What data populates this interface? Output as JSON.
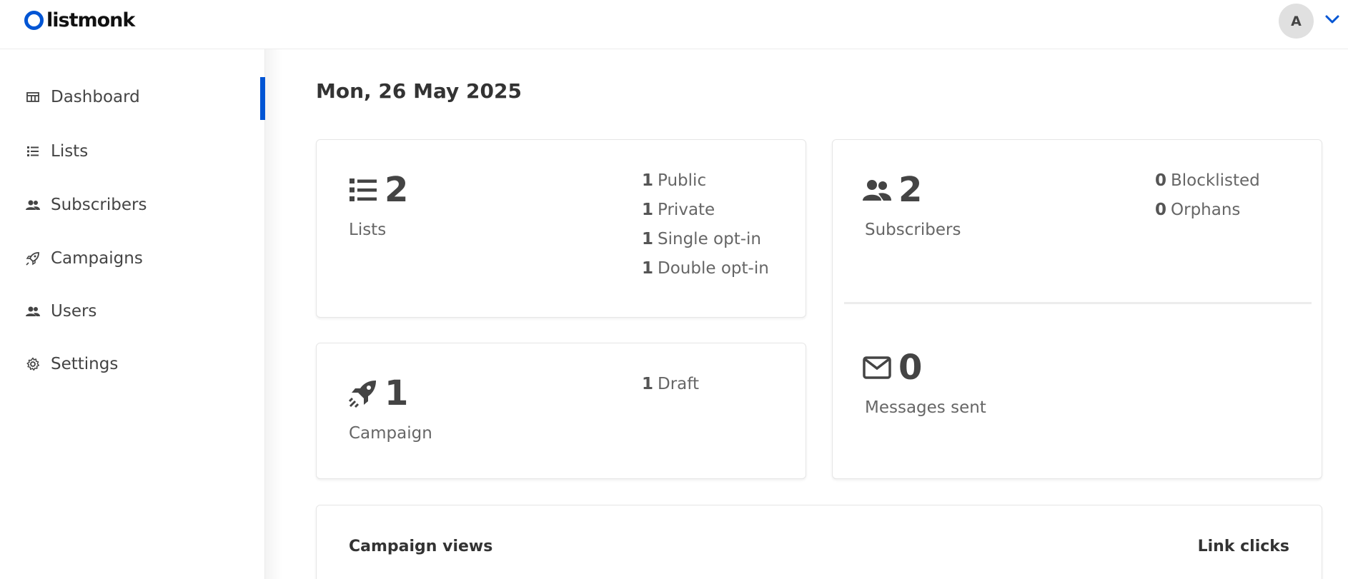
{
  "brand": {
    "name": "listmonk",
    "color": "#0055d4"
  },
  "header": {
    "avatar_letter": "A",
    "menu_icon": "chevron-down-icon"
  },
  "sidebar": {
    "items": [
      {
        "label": "Dashboard",
        "icon": "dashboard-icon",
        "active": true
      },
      {
        "label": "Lists",
        "icon": "list-icon"
      },
      {
        "label": "Subscribers",
        "icon": "users-icon"
      },
      {
        "label": "Campaigns",
        "icon": "rocket-icon"
      },
      {
        "label": "Users",
        "icon": "users-icon"
      },
      {
        "label": "Settings",
        "icon": "gear-icon"
      }
    ]
  },
  "main": {
    "date": "Mon, 26 May 2025",
    "lists_card": {
      "count": "2",
      "label": "Lists",
      "stats": [
        {
          "value": "1",
          "label": "Public"
        },
        {
          "value": "1",
          "label": "Private"
        },
        {
          "value": "1",
          "label": "Single opt-in"
        },
        {
          "value": "1",
          "label": "Double opt-in"
        }
      ]
    },
    "campaigns_card": {
      "count": "1",
      "label": "Campaign",
      "stats": [
        {
          "value": "1",
          "label": "Draft"
        }
      ]
    },
    "subscribers_card": {
      "count": "2",
      "label": "Subscribers",
      "stats": [
        {
          "value": "0",
          "label": "Blocklisted"
        },
        {
          "value": "0",
          "label": "Orphans"
        }
      ]
    },
    "messages_card": {
      "count": "0",
      "label": "Messages sent"
    },
    "charts": {
      "views_title": "Campaign views",
      "clicks_title": "Link clicks"
    }
  }
}
